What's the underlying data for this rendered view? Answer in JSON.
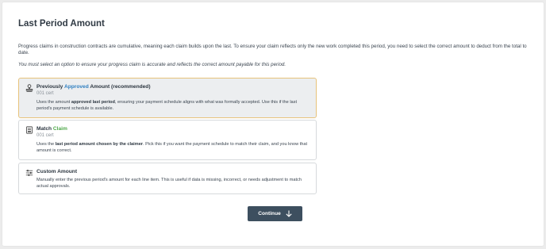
{
  "page": {
    "title": "Last Period Amount",
    "intro": "Progress claims in construction contracts are cumulative, meaning each claim builds upon the last. To ensure your claim reflects only the new work completed this period, you need to select the correct amount to deduct from the total to date.",
    "note": "You must select an option to ensure your progress claim is accurate and reflects the correct amount payable for this period."
  },
  "options": [
    {
      "title_pre": "Previously ",
      "title_highlight": "Approved",
      "title_post": " Amount (recommended)",
      "highlight_color": "#2f7fc0",
      "subtitle": "001 cert",
      "desc_pre": "Uses the amount ",
      "desc_bold": "approved last period",
      "desc_post": ", ensuring your payment schedule aligns with what was formally accepted. Use this if the last period's payment schedule is available.",
      "icon": "stamp-icon",
      "selected": true
    },
    {
      "title_pre": "Match ",
      "title_highlight": "Claim",
      "title_post": "",
      "highlight_color": "#4fa84a",
      "subtitle": "001 cert",
      "desc_pre": "Uses the ",
      "desc_bold": "last period amount chosen by the claimer",
      "desc_post": ". Pick this if you want the payment schedule to match their claim, and you know that amount is correct.",
      "icon": "document-icon",
      "selected": false
    },
    {
      "title_pre": "Custom Amount",
      "title_highlight": "",
      "title_post": "",
      "highlight_color": "",
      "subtitle": "",
      "desc_pre": "Manually enter the previous period's amount for each line item. This is useful if data is missing, incorrect, or needs adjustment to match actual approvals.",
      "desc_bold": "",
      "desc_post": "",
      "icon": "sliders-icon",
      "selected": false
    }
  ],
  "actions": {
    "continue_label": "Continue",
    "continue_icon": "arrow-down-icon"
  },
  "colors": {
    "selected_border": "#e7c27a",
    "button_bg": "#3d4f5f"
  }
}
